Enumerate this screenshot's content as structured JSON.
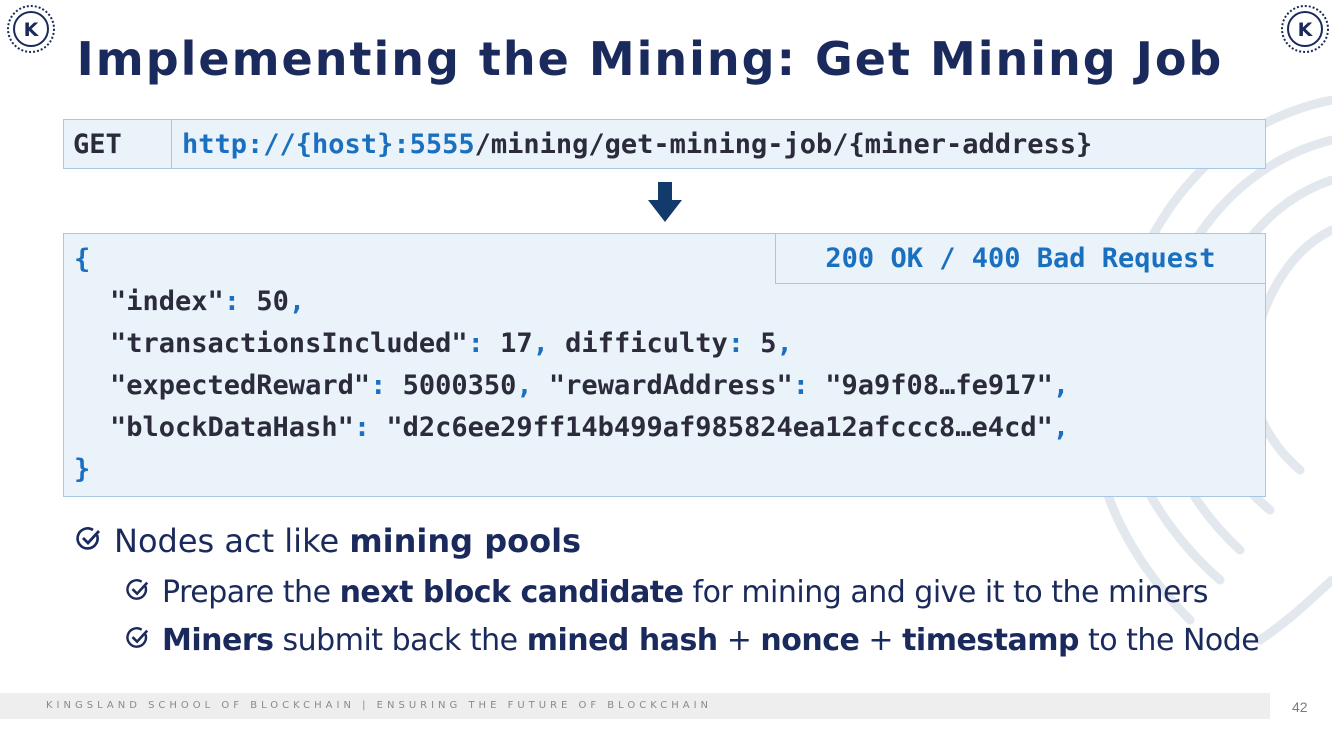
{
  "slide": {
    "title": "Implementing the Mining: Get Mining Job",
    "logo_letter": "K",
    "request": {
      "method": "GET",
      "url_host": "http://{host}:5555",
      "url_path": "/mining/get-mining-job/{miner-address}"
    },
    "response": {
      "status": "200 OK / 400 Bad Request",
      "open_brace": "{",
      "close_brace": "}",
      "line1": {
        "key": "\"index\"",
        "value": "50"
      },
      "line2": {
        "key": "\"transactionsIncluded\"",
        "value": "17",
        "key2": "difficulty",
        "value2": "5"
      },
      "line3": {
        "key": "\"expectedReward\"",
        "value": "5000350",
        "key2": "\"rewardAddress\"",
        "value2": "\"9a9f08…fe917\""
      },
      "line4": {
        "key": "\"blockDataHash\"",
        "value": "\"d2c6ee29ff14b499af985824ea12afccc8…e4cd\""
      }
    },
    "bullets": [
      {
        "pre": "Nodes act like ",
        "bold1": "mining pools"
      },
      {
        "pre": "Prepare the ",
        "bold1": "next block candidate",
        "post": " for mining and give it to the miners"
      },
      {
        "bold1": "Miners",
        "mid1": " submit back the ",
        "bold2": "mined hash",
        "mid2": " + ",
        "bold3": "nonce",
        "mid3": " + ",
        "bold4": "timestamp",
        "post": " to the Node"
      }
    ],
    "footer": "KINGSLAND SCHOOL OF BLOCKCHAIN | ENSURING THE FUTURE OF BLOCKCHAIN",
    "page_number": "42",
    "colors": {
      "title": "#1b2a5c",
      "accent": "#1a6fbf",
      "box_bg": "#eaf2fa",
      "box_border": "#a9c6e4"
    }
  }
}
